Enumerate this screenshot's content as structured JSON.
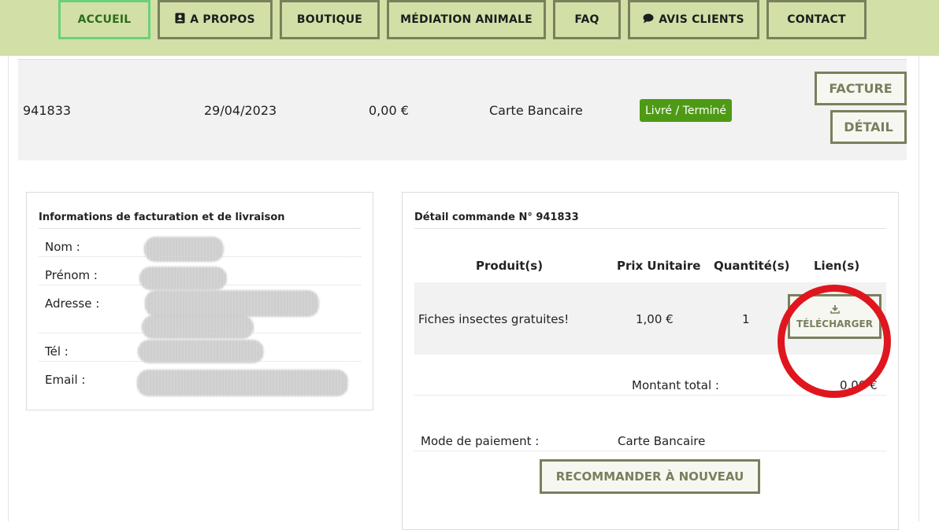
{
  "nav": {
    "items": [
      {
        "label": "ACCUEIL",
        "icon": "",
        "active": true
      },
      {
        "label": "A PROPOS",
        "icon": "contact-card-icon",
        "active": false
      },
      {
        "label": "BOUTIQUE",
        "icon": "",
        "active": false
      },
      {
        "label": "MÉDIATION ANIMALE",
        "icon": "",
        "active": false
      },
      {
        "label": "FAQ",
        "icon": "",
        "active": false
      },
      {
        "label": "AVIS CLIENTS",
        "icon": "chat-bubble-icon",
        "active": false
      },
      {
        "label": "CONTACT",
        "icon": "",
        "active": false
      }
    ]
  },
  "order": {
    "number": "941833",
    "date": "29/04/2023",
    "amount": "0,00 €",
    "payment": "Carte Bancaire",
    "status": "Livré / Terminé",
    "invoice_label": "FACTURE",
    "detail_label": "DÉTAIL"
  },
  "billing": {
    "title": "Informations de facturation et de livraison",
    "fields": {
      "nom": "Nom :",
      "prenom": "Prénom :",
      "adresse": "Adresse :",
      "tel": "Tél :",
      "email": "Email :"
    }
  },
  "detail": {
    "title": "Détail commande N° 941833",
    "headers": {
      "product": "Produit(s)",
      "unit_price": "Prix Unitaire",
      "quantity": "Quantité(s)",
      "link": "Lien(s)"
    },
    "item": {
      "product": "Fiches insectes gratuites!",
      "unit_price": "1,00 €",
      "quantity": "1",
      "download_label": "TÉLÉCHARGER"
    },
    "total_label": "Montant total :",
    "total_value": "0,00 €",
    "payment_label": "Mode de paiement :",
    "payment_value": "Carte Bancaire",
    "reorder_label": "RECOMMANDER À NOUVEAU"
  },
  "colors": {
    "nav_bg": "#d2e0a7",
    "button_border": "#7a7f5c",
    "status_green": "#4e9a15",
    "annotation_red": "#e0161e"
  }
}
